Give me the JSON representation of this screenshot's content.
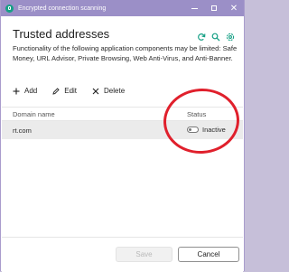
{
  "window": {
    "title": "Encrypted connection scanning",
    "controls": {
      "minimize": "minimize",
      "maximize": "maximize",
      "close": "close"
    }
  },
  "page": {
    "heading": "Trusted addresses",
    "description": "Functionality of the following application components may be limited: Safe Money, URL Advisor, Private Browsing, Web Anti-Virus, and Anti-Banner.",
    "header_icons": [
      "refresh-icon",
      "search-icon",
      "settings-icon"
    ]
  },
  "toolbar": {
    "add_label": "Add",
    "edit_label": "Edit",
    "delete_label": "Delete"
  },
  "table": {
    "columns": [
      "Domain name",
      "Status"
    ],
    "rows": [
      {
        "domain": "rt.com",
        "status": "Inactive",
        "toggle_on": false
      }
    ]
  },
  "footer": {
    "save_label": "Save",
    "cancel_label": "Cancel"
  },
  "colors": {
    "titlebar": "#9b8fc7",
    "accent": "#16a085",
    "annotation": "#e0202c"
  }
}
